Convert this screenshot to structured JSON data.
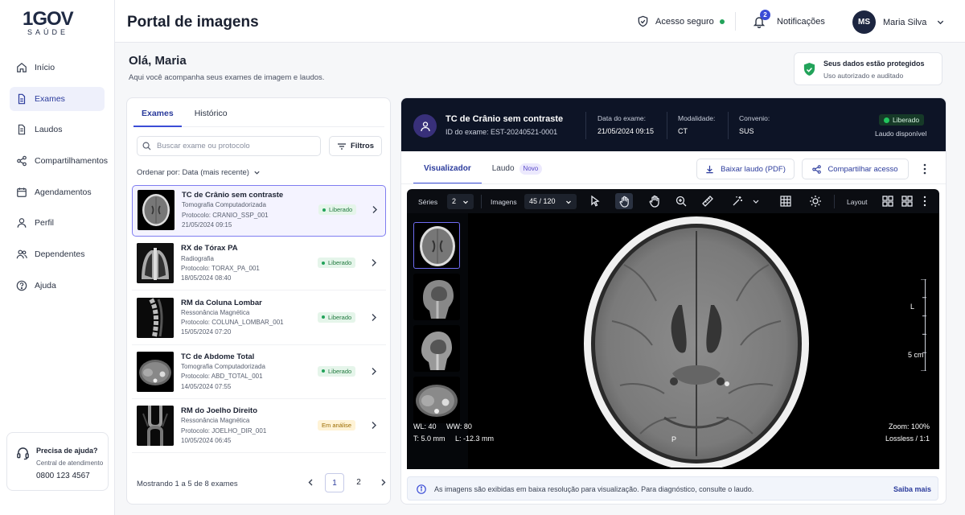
{
  "brand": {
    "logo_top": "1GOV",
    "logo_bottom": "SAÚDE"
  },
  "sidebar": {
    "items": [
      {
        "label": "Início",
        "icon": "home-icon"
      },
      {
        "label": "Exames",
        "icon": "file-icon",
        "active": true
      },
      {
        "label": "Laudos",
        "icon": "document-icon"
      },
      {
        "label": "Compartilhamentos",
        "icon": "share-icon"
      },
      {
        "label": "Agendamentos",
        "icon": "calendar-icon"
      },
      {
        "label": "Perfil",
        "icon": "user-icon"
      },
      {
        "label": "Dependentes",
        "icon": "users-icon"
      },
      {
        "label": "Ajuda",
        "icon": "help-icon"
      }
    ],
    "help": {
      "title": "Precisa de ajuda?",
      "subtitle": "Central de atendimento",
      "phone": "0800 123 4567"
    }
  },
  "header": {
    "title": "Portal de imagens",
    "secure": "Acesso seguro",
    "notifications": "Notificações",
    "notif_count": "2",
    "user_initials": "MS",
    "user_name": "Maria Silva"
  },
  "greeting": {
    "title": "Olá, Maria",
    "subtitle": "Aqui você acompanha seus exames de imagem e laudos."
  },
  "protection": {
    "title": "Seus dados estão protegidos",
    "subtitle": "Uso autorizado e auditado"
  },
  "list": {
    "tabs": [
      "Exames",
      "Histórico"
    ],
    "search_placeholder": "Buscar exame ou protocolo",
    "filters": "Filtros",
    "sort": "Ordenar por: Data (mais recente)",
    "exams": [
      {
        "name": "TC de Crânio sem contraste",
        "type": "Tomografia Computadorizada",
        "protocol": "Protocolo: CRANIO_SSP_001",
        "date": "21/05/2024  09:15",
        "status": "Liberado",
        "status_kind": "ok",
        "selected": true,
        "image": "brain-ct"
      },
      {
        "name": "RX de Tórax PA",
        "type": "Radiografia",
        "protocol": "Protocolo: TORAX_PA_001",
        "date": "18/05/2024  08:40",
        "status": "Liberado",
        "status_kind": "ok",
        "image": "chest-xray"
      },
      {
        "name": "RM da Coluna Lombar",
        "type": "Ressonância Magnética",
        "protocol": "Protocolo: COLUNA_LOMBAR_001",
        "date": "15/05/2024  07:20",
        "status": "Liberado",
        "status_kind": "ok",
        "image": "spine-mri"
      },
      {
        "name": "TC de Abdome Total",
        "type": "Tomografia Computadorizada",
        "protocol": "Protocolo: ABD_TOTAL_001",
        "date": "14/05/2024  07:55",
        "status": "Liberado",
        "status_kind": "ok",
        "image": "abdomen-ct"
      },
      {
        "name": "RM do Joelho Direito",
        "type": "Ressonância Magnética",
        "protocol": "Protocolo: JOELHO_DIR_001",
        "date": "10/05/2024  06:45",
        "status": "Em análise",
        "status_kind": "analysis",
        "image": "knee-mri"
      }
    ],
    "pagination": {
      "summary": "Mostrando 1 a 5 de 8 exames",
      "pages": [
        "1",
        "2"
      ],
      "current": "1"
    }
  },
  "viewer": {
    "title": "TC de Crânio sem contraste",
    "exam_id": "ID do exame: EST-20240521-0001",
    "date_label": "Data do exame:",
    "date": "21/05/2024 09:15",
    "modality_label": "Modalidade:",
    "modality": "CT",
    "insurance_label": "Convenio:",
    "insurance": "SUS",
    "status": "Liberado",
    "report_status": "Laudo disponível",
    "tabs": {
      "viewer": "Visualizador",
      "report": "Laudo",
      "report_badge": "Novo"
    },
    "download": "Baixar laudo (PDF)",
    "share": "Compartilhar acesso",
    "toolbar": {
      "series_label": "Séries",
      "series": "2",
      "images_label": "Imagens",
      "images": "45 / 120",
      "layout": "Layout"
    },
    "overlay": {
      "wl": "WL:  40",
      "ww": "WW:  80",
      "t": "T:  5.0 mm",
      "l": "L:  -12.3 mm",
      "zoom": "Zoom:  100%",
      "lossless": "Lossless / 1:1",
      "orient_bottom": "P",
      "orient_right": "L",
      "scale": "5 cm"
    },
    "info": "As imagens são exibidas em baixa resolução para visualização. Para diagnóstico, consulte o laudo.",
    "learn_more": "Saiba mais"
  }
}
